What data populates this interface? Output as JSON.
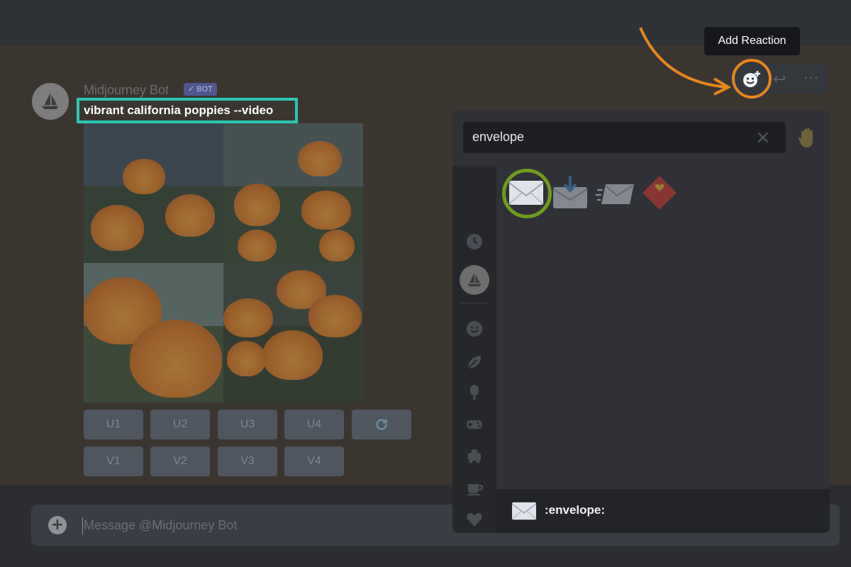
{
  "message": {
    "username": "Midjourney Bot",
    "bot_badge": "BOT",
    "prompt": "vibrant california poppies --video"
  },
  "buttons": {
    "upscale": [
      "U1",
      "U2",
      "U3",
      "U4"
    ],
    "variation": [
      "V1",
      "V2",
      "V3",
      "V4"
    ]
  },
  "composer": {
    "placeholder": "Message @Midjourney Bot"
  },
  "message_toolbar": {
    "tooltip": "Add Reaction"
  },
  "emoji_picker": {
    "search_value": "envelope",
    "results": [
      "envelope-emoji",
      "incoming-envelope-emoji",
      "e-mail-emoji",
      "love-letter-emoji"
    ],
    "selected_preview_name": ":envelope:"
  },
  "colors": {
    "highlight_prompt": "#2ec6b5",
    "highlight_reaction": "#e7861c",
    "highlight_selected_emoji": "#6f9b1c"
  }
}
